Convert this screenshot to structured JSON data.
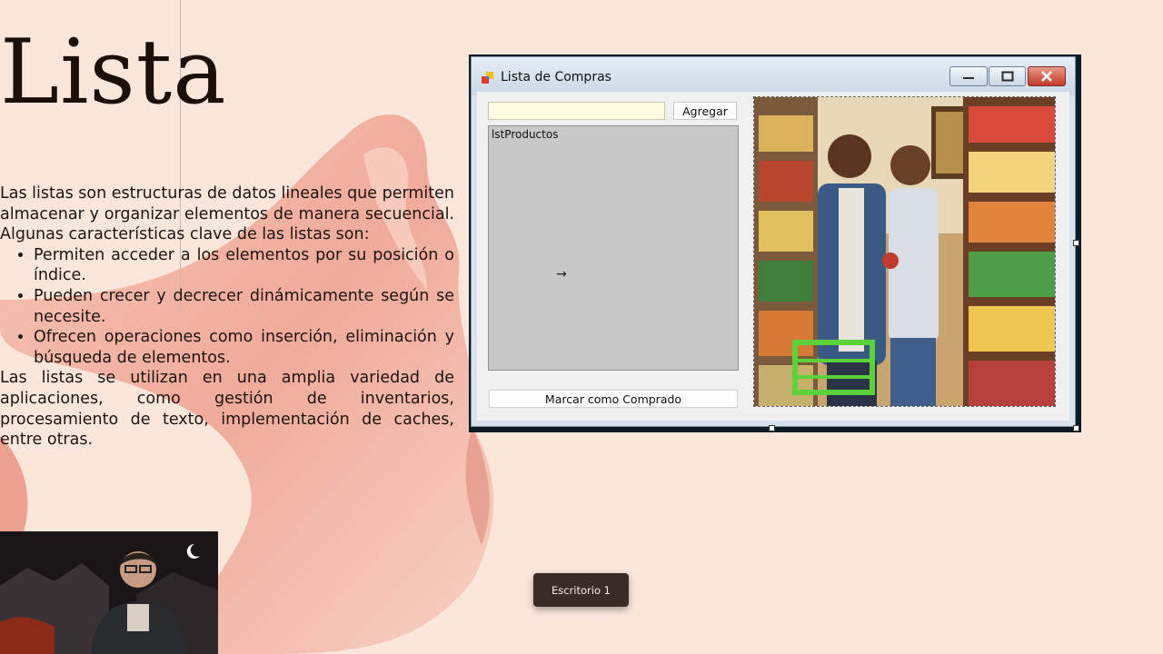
{
  "slide": {
    "title": "Lista",
    "intro": "Las listas son estructuras de datos lineales que permiten almacenar y organizar elementos de manera secuencial. Algunas características clave de las listas son:",
    "bullets": [
      "Permiten acceder a los elementos por su posición o índice.",
      "Pueden crecer y decrecer dinámicamente según se necesite.",
      "Ofrecen operaciones como inserción, eliminación y búsqueda de elementos."
    ],
    "closing": "Las listas se utilizan en una amplia variedad de aplicaciones, como gestión de inventarios, procesamiento de texto, implementación de caches, entre otras."
  },
  "window": {
    "title": "Lista de Compras",
    "icon": "form-icon",
    "product_input_value": "",
    "add_button": "Agregar",
    "listbox_name": "lstProductos",
    "mark_button": "Marcar como Comprado",
    "picture": "supermarket-couple-photo"
  },
  "taskbar": {
    "desktop_tooltip": "Escritorio 1"
  },
  "colors": {
    "background": "#fbe6dc",
    "silk": "#f0a898",
    "input_bg": "#fefde3",
    "listbox_bg": "#c8c8c8",
    "close_button": "#c4392a"
  }
}
